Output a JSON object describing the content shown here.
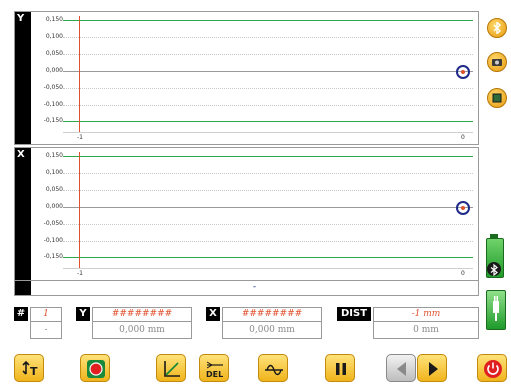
{
  "plot_y": {
    "axis_label": "Y",
    "ticks": [
      "0,150",
      "0,100",
      "0,050",
      "0,000",
      "-0,050",
      "-0,100",
      "-0,150"
    ],
    "x_min": "-1",
    "x_max": "0"
  },
  "plot_x": {
    "axis_label": "X",
    "ticks": [
      "0,150",
      "0,100",
      "0,050",
      "0,000",
      "-0,050",
      "-0,100",
      "-0,150"
    ],
    "x_min": "-1",
    "x_max": "0"
  },
  "status_bar": {
    "text": "-"
  },
  "readout": {
    "index_label": "#",
    "index_value": "1",
    "index_sub": "-",
    "y_label": "Y",
    "y_value": "########",
    "y_mm": "0,000 mm",
    "x_label": "X",
    "x_value": "########",
    "x_mm": "0,000 mm",
    "dist_label": "DIST",
    "dist_value": "-1 mm",
    "dist_mm": "0 mm"
  },
  "colors": {
    "limit_line": "#2aa84a",
    "cursor_line": "#e0522f",
    "button_yellow": "#f0b41b",
    "target_ring": "#1e2a8a"
  },
  "icons": {
    "side": [
      "bluetooth-icon",
      "camera-icon",
      "screen-icon"
    ],
    "toolbar": [
      "tare-icon",
      "record-icon",
      "slope-icon",
      "delete-icon",
      "wave-icon",
      "pause-icon",
      "prev-icon",
      "next-icon",
      "power-icon"
    ]
  }
}
